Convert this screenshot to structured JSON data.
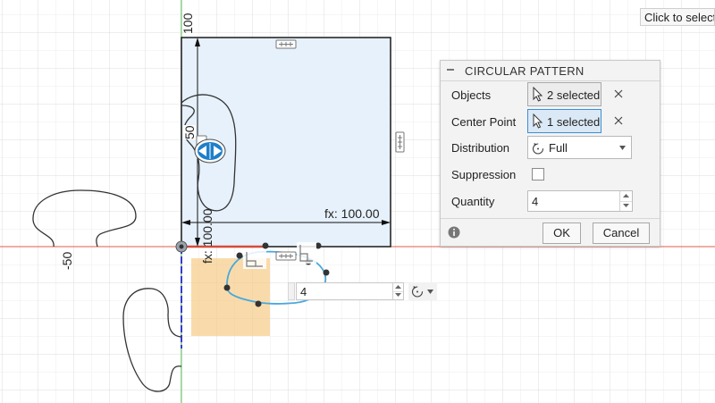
{
  "tooltip": {
    "text": "Click to select s"
  },
  "canvas": {
    "dim_top": "100",
    "dim_left": "50",
    "dim_neg": "-50",
    "dim_fx_h": "fx: 100.00",
    "dim_fx_v": "fx: 100.00",
    "quantity_value": "4"
  },
  "dialog": {
    "title": "CIRCULAR PATTERN",
    "objects": {
      "label": "Objects",
      "value": "2 selected"
    },
    "center_point": {
      "label": "Center Point",
      "value": "1 selected"
    },
    "distribution": {
      "label": "Distribution",
      "value": "Full"
    },
    "suppression": {
      "label": "Suppression",
      "checked": false
    },
    "quantity": {
      "label": "Quantity",
      "value": "4"
    },
    "ok_label": "OK",
    "cancel_label": "Cancel"
  },
  "colors": {
    "selection_fill": "#e6f1fb",
    "selection_outline": "#1a1a1a",
    "preview_fill": "#f7cf8f",
    "curve_blue": "#4aa8dc",
    "axis_red": "#e25c4c",
    "axis_green": "#5ec45e",
    "axis_blue": "#3a3ad0",
    "accent": "#3b8fd4"
  },
  "icons": {
    "collapse": "minus-icon",
    "select": "cursor-arrow-icon",
    "clear": "close-icon",
    "distribution": "circular-arrow-icon",
    "info": "info-icon",
    "flip": "flip-direction-icon",
    "constraint": "constraint-icon"
  }
}
